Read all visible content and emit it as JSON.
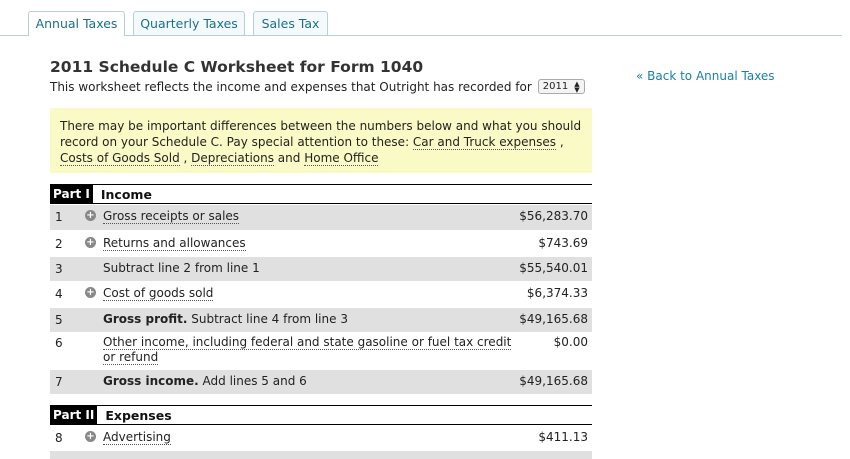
{
  "tabs": [
    {
      "label": "Annual Taxes",
      "active": true
    },
    {
      "label": "Quarterly Taxes",
      "active": false
    },
    {
      "label": "Sales Tax",
      "active": false
    }
  ],
  "header": {
    "title": "2011 Schedule C Worksheet for Form 1040",
    "subtitle": "This worksheet reflects the income and expenses that Outright has recorded for",
    "year": "2011",
    "back_link": "« Back to Annual Taxes"
  },
  "notice": {
    "text_pre": "There may be important differences between the numbers below and what you should record on your Schedule C. Pay special attention to these: ",
    "link1": "Car and Truck expenses",
    "sep1": " , ",
    "link2": "Costs of Goods Sold",
    "sep2": " , ",
    "link3": "Depreciations",
    "sep3": " and ",
    "link4": "Home Office"
  },
  "part1": {
    "label": "Part I",
    "title": "Income"
  },
  "part2": {
    "label": "Part II",
    "title": "Expenses"
  },
  "rows": [
    {
      "num": "1",
      "expand": true,
      "desc": "Gross receipts or sales",
      "amount": "$56,283.70"
    },
    {
      "num": "2",
      "expand": true,
      "desc": "Returns and allowances",
      "amount": "$743.69"
    },
    {
      "num": "3",
      "expand": false,
      "desc": "Subtract line 2 from line 1",
      "amount": "$55,540.01"
    },
    {
      "num": "4",
      "expand": true,
      "desc": "Cost of goods sold",
      "amount": "$6,374.33"
    },
    {
      "num": "5",
      "expand": false,
      "bold": "Gross profit.",
      "desc": " Subtract line 4 from line 3",
      "amount": "$49,165.68"
    },
    {
      "num": "6",
      "expand": false,
      "desc": "Other income, including federal and state gasoline or fuel tax credit or refund",
      "amount": "$0.00"
    },
    {
      "num": "7",
      "expand": false,
      "bold": "Gross income.",
      "desc": " Add lines 5 and 6",
      "amount": "$49,165.68"
    },
    {
      "num": "8",
      "expand": true,
      "desc": "Advertising",
      "amount": "$411.13"
    }
  ],
  "icons": {
    "expand": "plus-circle-icon",
    "select_arrows": "up-down-arrows-icon"
  }
}
